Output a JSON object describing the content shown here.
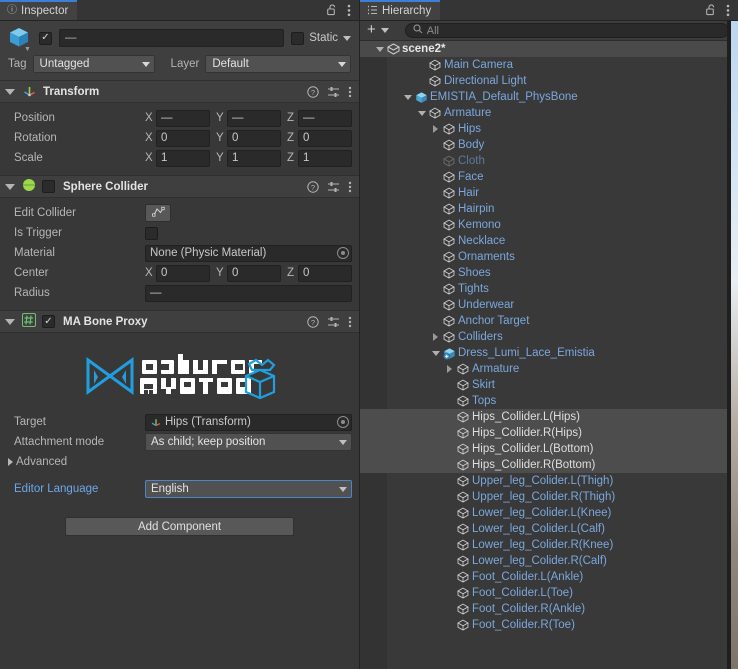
{
  "inspector": {
    "tab_label": "Inspector",
    "tab_icon": "info-icon",
    "lock_icon": "lock-open-icon",
    "menu_icon": "kebab-menu-icon",
    "gameobject": {
      "icon": "gameobject-cube-icon",
      "enabled": true,
      "name": "—",
      "static_label": "Static",
      "static_checked": false,
      "tag_label": "Tag",
      "tag_value": "Untagged",
      "layer_label": "Layer",
      "layer_value": "Default"
    },
    "components": [
      {
        "title": "Transform",
        "icon": "transform-axis-icon",
        "expanded": true,
        "help_icon": "help-icon",
        "preset_icon": "preset-sliders-icon",
        "menu_icon": "kebab-menu-icon",
        "rows": [
          {
            "label": "Position",
            "x": "—",
            "y": "—",
            "z": "—"
          },
          {
            "label": "Rotation",
            "x": "0",
            "y": "0",
            "z": "0"
          },
          {
            "label": "Scale",
            "x": "1",
            "y": "1",
            "z": "1"
          }
        ]
      },
      {
        "title": "Sphere Collider",
        "icon": "sphere-collider-icon",
        "expanded": true,
        "enabled": false,
        "edit_collider_label": "Edit Collider",
        "edit_collider_icon": "edit-collider-icon",
        "is_trigger_label": "Is Trigger",
        "is_trigger_checked": false,
        "material_label": "Material",
        "material_value": "None (Physic Material)",
        "center_label": "Center",
        "center": {
          "x": "0",
          "y": "0",
          "z": "0"
        },
        "radius_label": "Radius",
        "radius_value": "—"
      },
      {
        "title": "MA Bone Proxy",
        "icon": "script-hash-icon",
        "expanded": true,
        "enabled": true,
        "logo_text_top": "odular",
        "logo_text_bottom": "Avatar",
        "logo_color": "#1f9fe0",
        "target_label": "Target",
        "target_value": "Hips (Transform)",
        "attachment_label": "Attachment mode",
        "attachment_value": "As child; keep position",
        "advanced_label": "Advanced",
        "editor_language_label": "Editor Language",
        "editor_language_value": "English"
      }
    ],
    "add_component_label": "Add Component"
  },
  "hierarchy": {
    "tab_label": "Hierarchy",
    "tab_icon": "hierarchy-list-icon",
    "lock_icon": "lock-open-icon",
    "menu_icon": "kebab-menu-icon",
    "add_button_label": "+",
    "add_caret_icon": "chevron-down-icon",
    "search_icon": "search-icon",
    "search_placeholder": "All",
    "search_value": "",
    "tree": [
      {
        "label": "scene2*",
        "depth": 0,
        "icon": "scene-icon",
        "twisty": "down",
        "style": "scene",
        "overflow": true
      },
      {
        "label": "Main Camera",
        "depth": 2,
        "icon": "gameobject-icon",
        "twisty": "none",
        "style": "blue"
      },
      {
        "label": "Directional Light",
        "depth": 2,
        "icon": "gameobject-icon",
        "twisty": "none",
        "style": "blue"
      },
      {
        "label": "EMISTIA_Default_PhysBone",
        "depth": 1,
        "icon": "prefab-icon",
        "twisty": "down",
        "style": "blue",
        "chevron": true
      },
      {
        "label": "Armature",
        "depth": 2,
        "icon": "gameobject-icon",
        "twisty": "down",
        "style": "blue"
      },
      {
        "label": "Hips",
        "depth": 3,
        "icon": "gameobject-icon",
        "twisty": "right",
        "style": "blue"
      },
      {
        "label": "Body",
        "depth": 3,
        "icon": "gameobject-icon",
        "twisty": "none",
        "style": "blue"
      },
      {
        "label": "Cloth",
        "depth": 3,
        "icon": "gameobject-icon",
        "twisty": "none",
        "style": "blue-dim"
      },
      {
        "label": "Face",
        "depth": 3,
        "icon": "gameobject-icon",
        "twisty": "none",
        "style": "blue"
      },
      {
        "label": "Hair",
        "depth": 3,
        "icon": "gameobject-icon",
        "twisty": "none",
        "style": "blue"
      },
      {
        "label": "Hairpin",
        "depth": 3,
        "icon": "gameobject-icon",
        "twisty": "none",
        "style": "blue"
      },
      {
        "label": "Kemono",
        "depth": 3,
        "icon": "gameobject-icon",
        "twisty": "none",
        "style": "blue"
      },
      {
        "label": "Necklace",
        "depth": 3,
        "icon": "gameobject-icon",
        "twisty": "none",
        "style": "blue"
      },
      {
        "label": "Ornaments",
        "depth": 3,
        "icon": "gameobject-icon",
        "twisty": "none",
        "style": "blue"
      },
      {
        "label": "Shoes",
        "depth": 3,
        "icon": "gameobject-icon",
        "twisty": "none",
        "style": "blue"
      },
      {
        "label": "Tights",
        "depth": 3,
        "icon": "gameobject-icon",
        "twisty": "none",
        "style": "blue"
      },
      {
        "label": "Underwear",
        "depth": 3,
        "icon": "gameobject-icon",
        "twisty": "none",
        "style": "blue"
      },
      {
        "label": "Anchor Target",
        "depth": 3,
        "icon": "gameobject-icon",
        "twisty": "none",
        "style": "blue"
      },
      {
        "label": "Colliders",
        "depth": 3,
        "icon": "gameobject-icon",
        "twisty": "right",
        "style": "blue"
      },
      {
        "label": "Dress_Lumi_Lace_Emistia",
        "depth": 3,
        "icon": "prefab-variant-icon",
        "twisty": "down",
        "style": "blue",
        "chevron": true
      },
      {
        "label": "Armature",
        "depth": 4,
        "icon": "gameobject-icon",
        "twisty": "right",
        "style": "blue"
      },
      {
        "label": "Skirt",
        "depth": 4,
        "icon": "gameobject-icon",
        "twisty": "none",
        "style": "blue"
      },
      {
        "label": "Tops",
        "depth": 4,
        "icon": "gameobject-icon",
        "twisty": "none",
        "style": "blue"
      },
      {
        "label": "Hips_Collider.L(Hips)",
        "depth": 4,
        "icon": "gameobject-icon",
        "twisty": "none",
        "style": "selected"
      },
      {
        "label": "Hips_Collider.R(Hips)",
        "depth": 4,
        "icon": "gameobject-icon",
        "twisty": "none",
        "style": "selected"
      },
      {
        "label": "Hips_Collider.L(Bottom)",
        "depth": 4,
        "icon": "gameobject-icon",
        "twisty": "none",
        "style": "selected"
      },
      {
        "label": "Hips_Collider.R(Bottom)",
        "depth": 4,
        "icon": "gameobject-icon",
        "twisty": "none",
        "style": "selected"
      },
      {
        "label": "Upper_leg_Colider.L(Thigh)",
        "depth": 4,
        "icon": "gameobject-icon",
        "twisty": "none",
        "style": "blue"
      },
      {
        "label": "Upper_leg_Colider.R(Thigh)",
        "depth": 4,
        "icon": "gameobject-icon",
        "twisty": "none",
        "style": "blue"
      },
      {
        "label": "Lower_leg_Colider.L(Knee)",
        "depth": 4,
        "icon": "gameobject-icon",
        "twisty": "none",
        "style": "blue"
      },
      {
        "label": "Lower_leg_Colider.L(Calf)",
        "depth": 4,
        "icon": "gameobject-icon",
        "twisty": "none",
        "style": "blue"
      },
      {
        "label": "Lower_leg_Colider.R(Knee)",
        "depth": 4,
        "icon": "gameobject-icon",
        "twisty": "none",
        "style": "blue"
      },
      {
        "label": "Lower_leg_Colider.R(Calf)",
        "depth": 4,
        "icon": "gameobject-icon",
        "twisty": "none",
        "style": "blue"
      },
      {
        "label": "Foot_Colider.L(Ankle)",
        "depth": 4,
        "icon": "gameobject-icon",
        "twisty": "none",
        "style": "blue"
      },
      {
        "label": "Foot_Colider.L(Toe)",
        "depth": 4,
        "icon": "gameobject-icon",
        "twisty": "none",
        "style": "blue"
      },
      {
        "label": "Foot_Colider.R(Ankle)",
        "depth": 4,
        "icon": "gameobject-icon",
        "twisty": "none",
        "style": "blue"
      },
      {
        "label": "Foot_Colider.R(Toe)",
        "depth": 4,
        "icon": "gameobject-icon",
        "twisty": "none",
        "style": "blue"
      }
    ]
  },
  "colors": {
    "panel_bg": "#383838",
    "header_bg": "#3f3f3f",
    "tab_active": "#424242",
    "tab_accent": "#3d7fd6",
    "prefab_blue": "#7ba7dd",
    "link_blue": "#6ba8e8",
    "selection": "#4d4d4d",
    "field_bg": "#2a2a2a"
  }
}
